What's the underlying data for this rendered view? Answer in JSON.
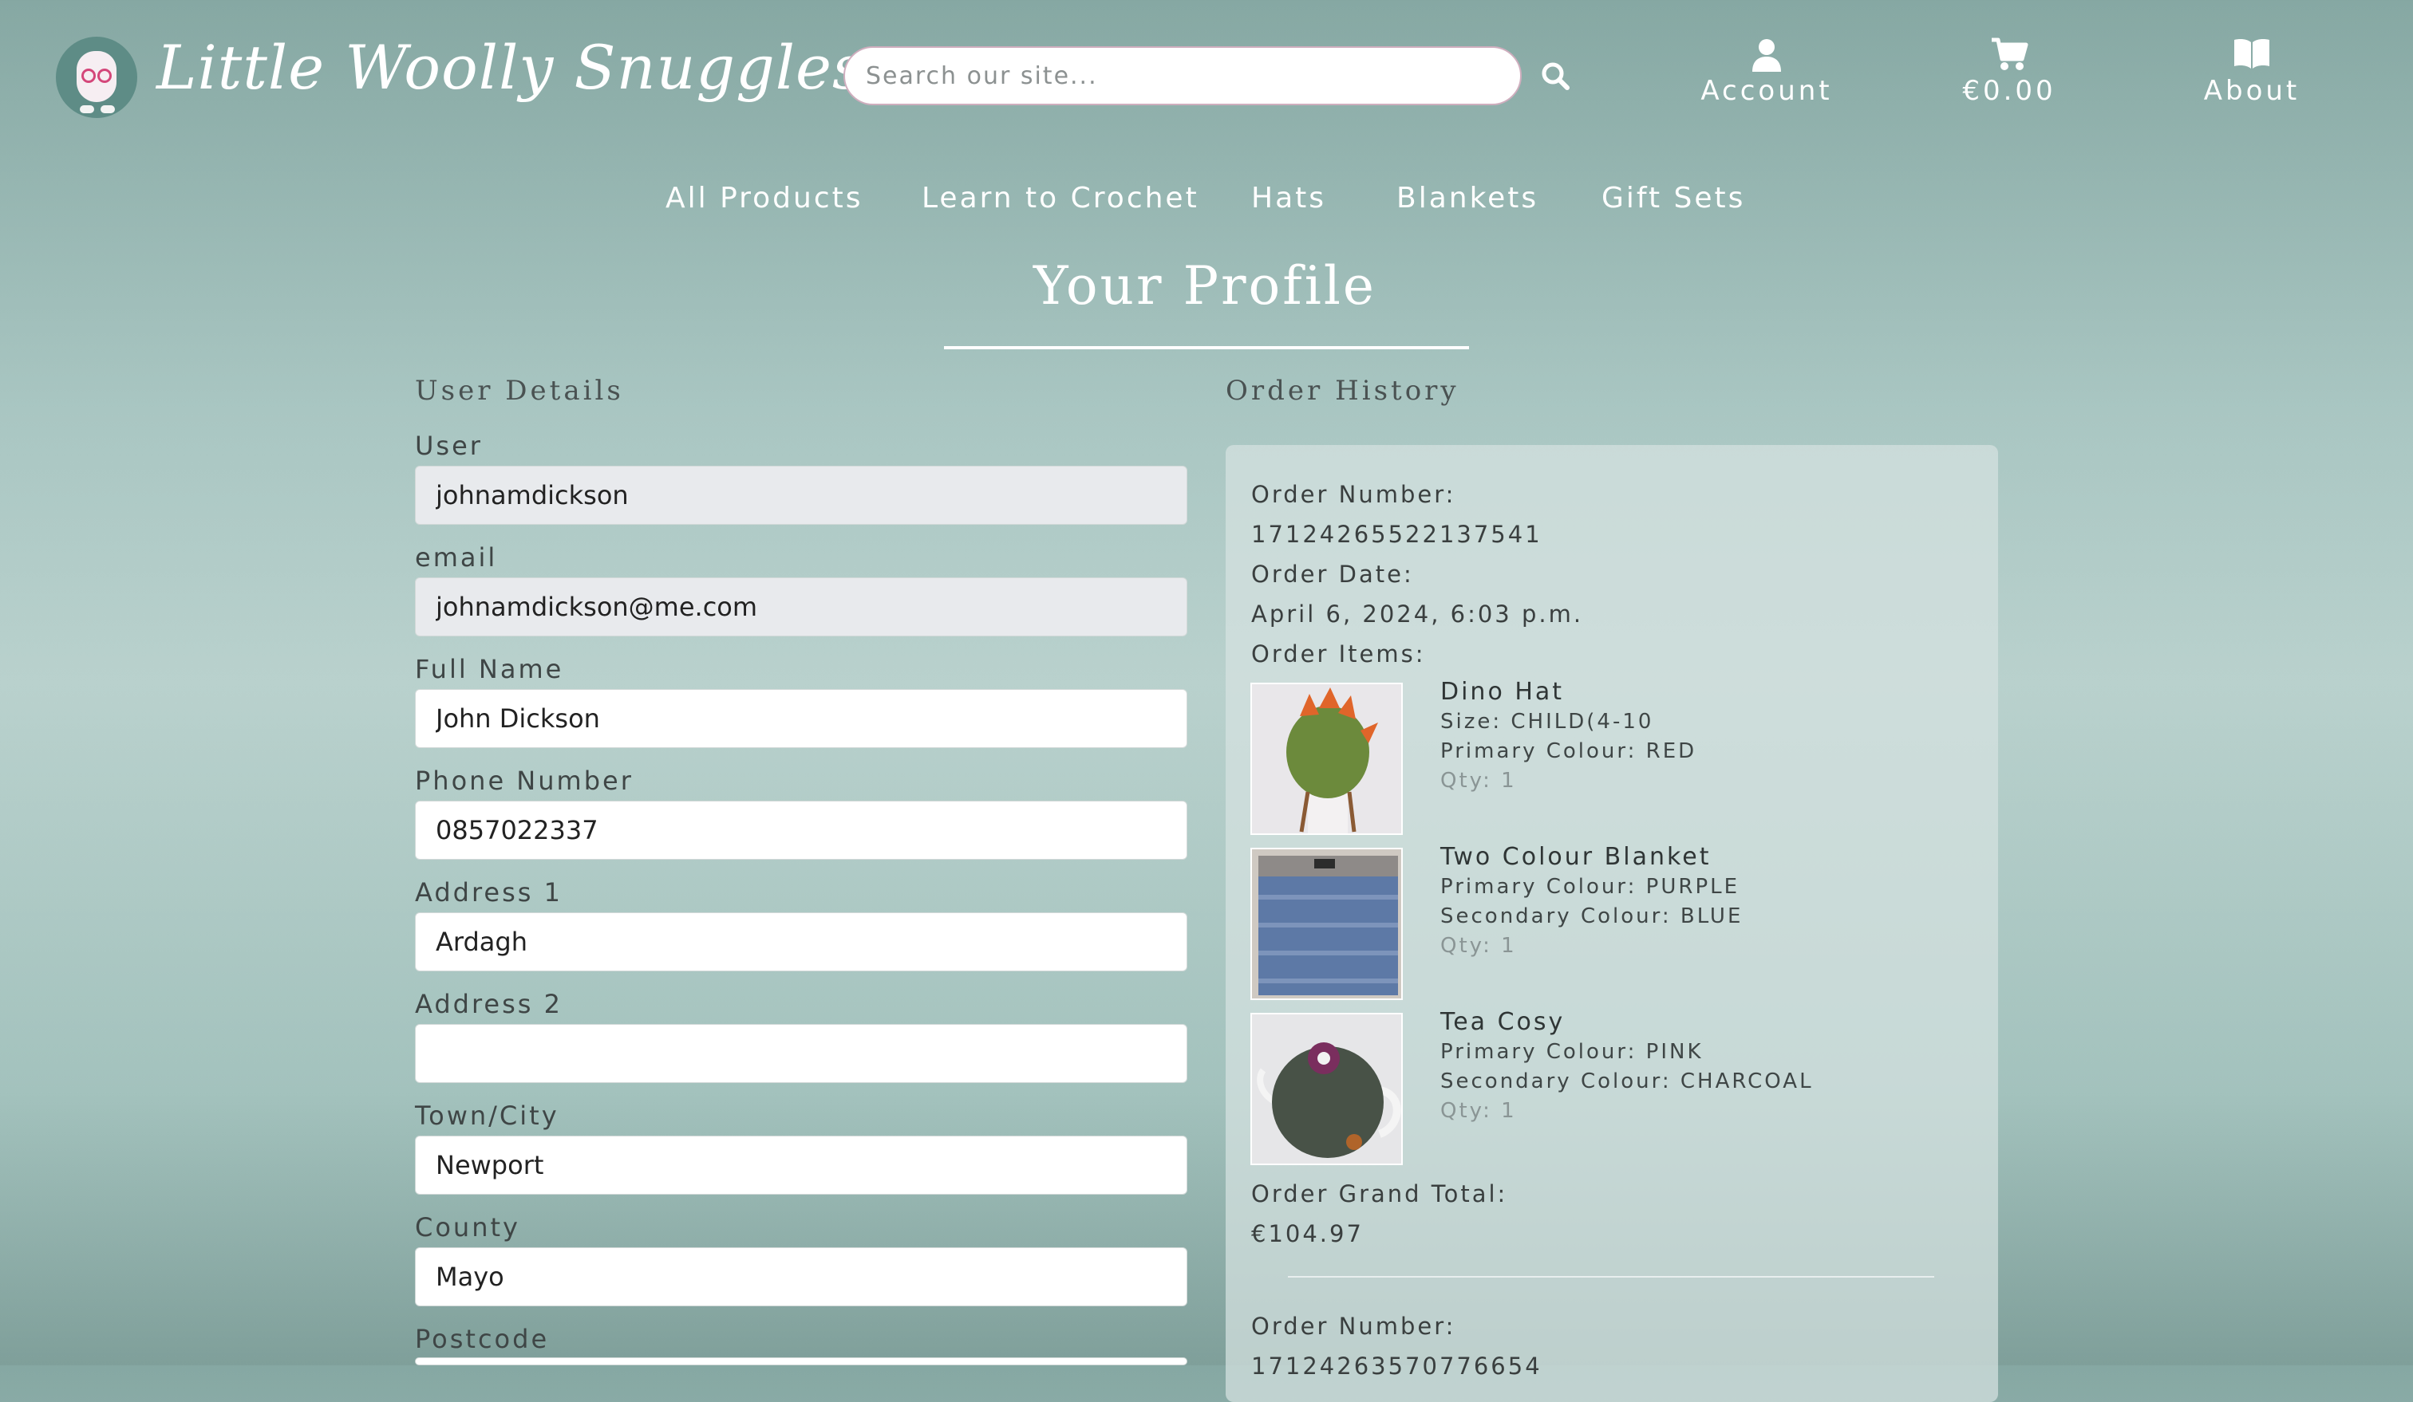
{
  "brand": {
    "name": "Little Woolly Snuggles"
  },
  "search": {
    "placeholder": "Search our site..."
  },
  "top_nav": [
    {
      "label": "Account",
      "icon": "user-icon"
    },
    {
      "label": "€0.00",
      "icon": "cart-icon"
    },
    {
      "label": "About",
      "icon": "book-icon"
    }
  ],
  "categories": [
    "All Products",
    "Learn to Crochet",
    "Hats",
    "Blankets",
    "Gift Sets"
  ],
  "page": {
    "title": "Your Profile"
  },
  "user_details": {
    "heading": "User Details",
    "fields": [
      {
        "label": "User",
        "value": "johnamdickson",
        "readonly": true
      },
      {
        "label": "email",
        "value": "johnamdickson@me.com",
        "readonly": true
      },
      {
        "label": "Full Name",
        "value": "John Dickson"
      },
      {
        "label": "Phone Number",
        "value": "0857022337"
      },
      {
        "label": "Address 1",
        "value": "Ardagh"
      },
      {
        "label": "Address 2",
        "value": ""
      },
      {
        "label": "Town/City",
        "value": "Newport"
      },
      {
        "label": "County",
        "value": "Mayo"
      },
      {
        "label": "Postcode",
        "value": ""
      }
    ]
  },
  "order_history": {
    "heading": "Order History",
    "orders": [
      {
        "number_label": "Order Number:",
        "number": "17124265522137541",
        "date_label": "Order Date:",
        "date": "April 6, 2024, 6:03 p.m.",
        "items_label": "Order Items:",
        "items": [
          {
            "name": "Dino Hat",
            "attrs": [
              "Size: CHILD(4-10",
              "Primary Colour: RED"
            ],
            "qty": "Qty: 1"
          },
          {
            "name": "Two Colour Blanket",
            "attrs": [
              "Primary Colour: PURPLE",
              "Secondary Colour: BLUE"
            ],
            "qty": "Qty: 1"
          },
          {
            "name": "Tea Cosy",
            "attrs": [
              "Primary Colour: PINK",
              "Secondary Colour: CHARCOAL"
            ],
            "qty": "Qty: 1"
          }
        ],
        "total_label": "Order Grand Total:",
        "total": "€104.97"
      },
      {
        "number_label": "Order Number:",
        "number": "17124263570776654"
      }
    ]
  },
  "colors": {
    "accent": "#5e8c86",
    "text": "#3a3f3f",
    "card": "#d6e2e1"
  }
}
